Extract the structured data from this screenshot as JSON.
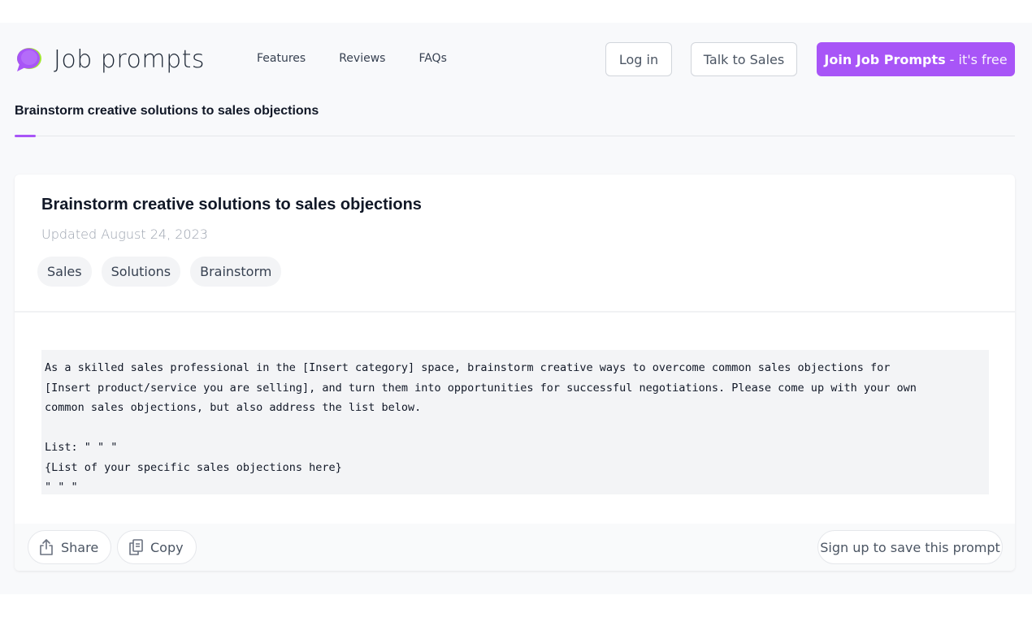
{
  "brand": {
    "name": "Job prompts",
    "accent": "#a855f7"
  },
  "nav": {
    "items": [
      "Features",
      "Reviews",
      "FAQs"
    ]
  },
  "header": {
    "login_label": "Log in",
    "sales_label": "Talk to Sales",
    "join_strong": "Join Job Prompts",
    "join_light": "- it's free"
  },
  "tab": {
    "label": "Brainstorm creative solutions to sales objections"
  },
  "card": {
    "title": "Brainstorm creative solutions to sales objections",
    "updated": "Updated August 24, 2023",
    "tags": [
      "Sales",
      "Solutions",
      "Brainstorm"
    ],
    "prompt": "As a skilled sales professional in the [Insert category] space, brainstorm creative ways to overcome common sales objections for\n[Insert product/service you are selling], and turn them into opportunities for successful negotiations. Please come up with your own\ncommon sales objections, but also address the list below.\n\nList: \" \" \"\n{List of your specific sales objections here}\n\" \" \""
  },
  "footer": {
    "share_label": "Share",
    "copy_label": "Copy",
    "signup_label": "Sign up to save this prompt",
    "icons": [
      "share-icon",
      "copy-icon"
    ]
  }
}
